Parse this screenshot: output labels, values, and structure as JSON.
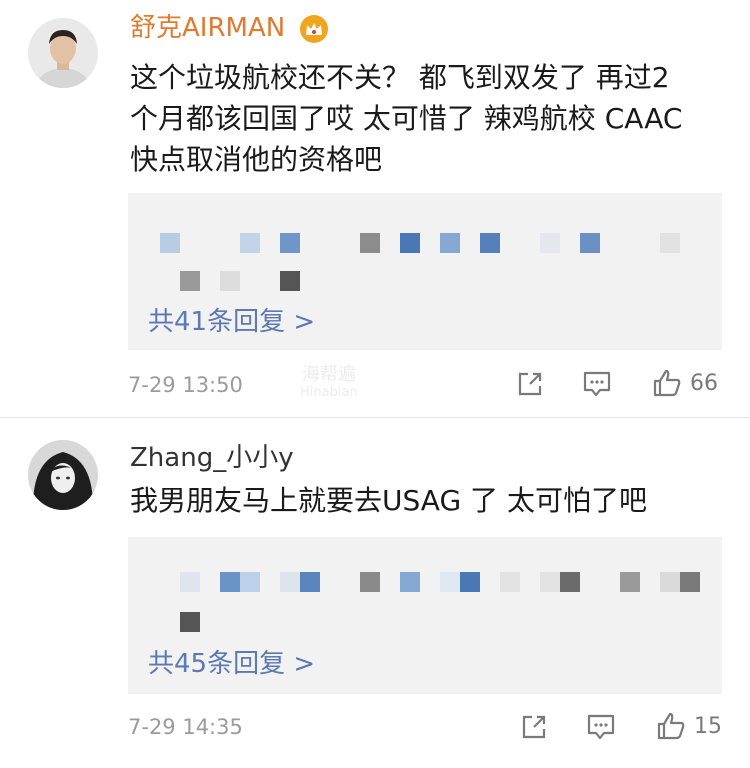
{
  "comments": [
    {
      "username": "舒克AIRMAN",
      "username_color": "#e07a2e",
      "lines": [
        "这个垃圾航校还不关？ 都飞到双发了 再过2",
        "个月都该回国了哎 太可惜了 辣鸡航校 CAAC",
        "快点取消他的资格吧"
      ],
      "more_replies": "共41条回复 >",
      "date": "7-29 13:50",
      "likes": "66"
    },
    {
      "username": "Zhang_小小y",
      "username_color": "#333333",
      "lines": [
        "我男朋友马上就要去USAG 了  太可怕了吧"
      ],
      "more_replies": "共45条回复 >",
      "date": "7-29 14:35",
      "likes": "15"
    }
  ],
  "watermark": {
    "line1": "海帮遍",
    "line2": "Hinabian"
  },
  "colors": {
    "link": "#5b79b3",
    "meta": "#9b9b9b",
    "reply_bg": "#f2f2f2"
  },
  "icons": [
    "verified-crown-icon",
    "share-icon",
    "comment-icon",
    "like-icon"
  ]
}
